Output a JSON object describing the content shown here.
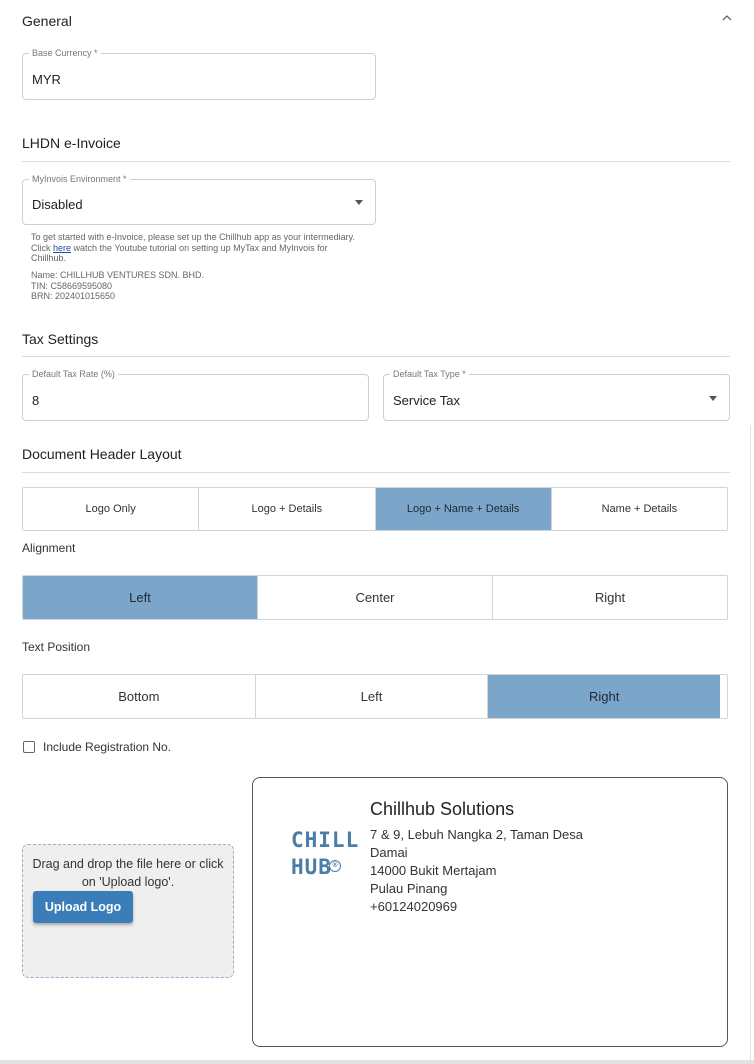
{
  "general": {
    "title": "General",
    "base_currency": {
      "label": "Base Currency *",
      "value": "MYR"
    }
  },
  "lhdn": {
    "title": "LHDN e-Invoice",
    "environment": {
      "label": "MyInvois Environment *",
      "value": "Disabled"
    },
    "note_before_link": "To get started with e-Invoice, please set up the Chillhub app as your intermediary. Click ",
    "note_link": "here",
    "note_after_link": " watch the Youtube tutorial on setting up MyTax and MyInvois for Chillhub.",
    "name_line": "Name: CHILLHUB VENTURES SDN. BHD.",
    "tin_line": "TIN: C58669595080",
    "brn_line": "BRN: 202401015650"
  },
  "tax": {
    "title": "Tax Settings",
    "rate": {
      "label": "Default Tax Rate (%)",
      "value": "8"
    },
    "type": {
      "label": "Default Tax Type *",
      "value": "Service Tax"
    }
  },
  "header_layout": {
    "title": "Document Header Layout",
    "options": [
      "Logo Only",
      "Logo + Details",
      "Logo + Name + Details",
      "Name + Details"
    ],
    "selected": "Logo + Name + Details"
  },
  "alignment": {
    "title": "Alignment",
    "options": [
      "Left",
      "Center",
      "Right"
    ],
    "selected": "Left"
  },
  "text_position": {
    "title": "Text Position",
    "options": [
      "Bottom",
      "Left",
      "Right"
    ],
    "selected": "Right"
  },
  "include_reg": {
    "label": "Include Registration No.",
    "checked": false
  },
  "upload": {
    "prompt": "Drag and drop the file here or click on 'Upload logo'.",
    "button": "Upload Logo"
  },
  "preview": {
    "logo_line1": "CHILL",
    "logo_line2": "HUB",
    "logo_mark": "®",
    "company": "Chillhub Solutions",
    "address": [
      "7 & 9, Lebuh Nangka 2, Taman Desa",
      "Damai",
      "14000 Bukit Mertajam",
      "Pulau Pinang",
      "+60124020969"
    ]
  },
  "colors": {
    "accent_selected": "#7ba5c9",
    "upload_button": "#3a7db8",
    "logo": "#4a7ea8"
  },
  "icons": {
    "collapse": "chevron-up-icon",
    "dropdown": "caret-down-icon"
  }
}
